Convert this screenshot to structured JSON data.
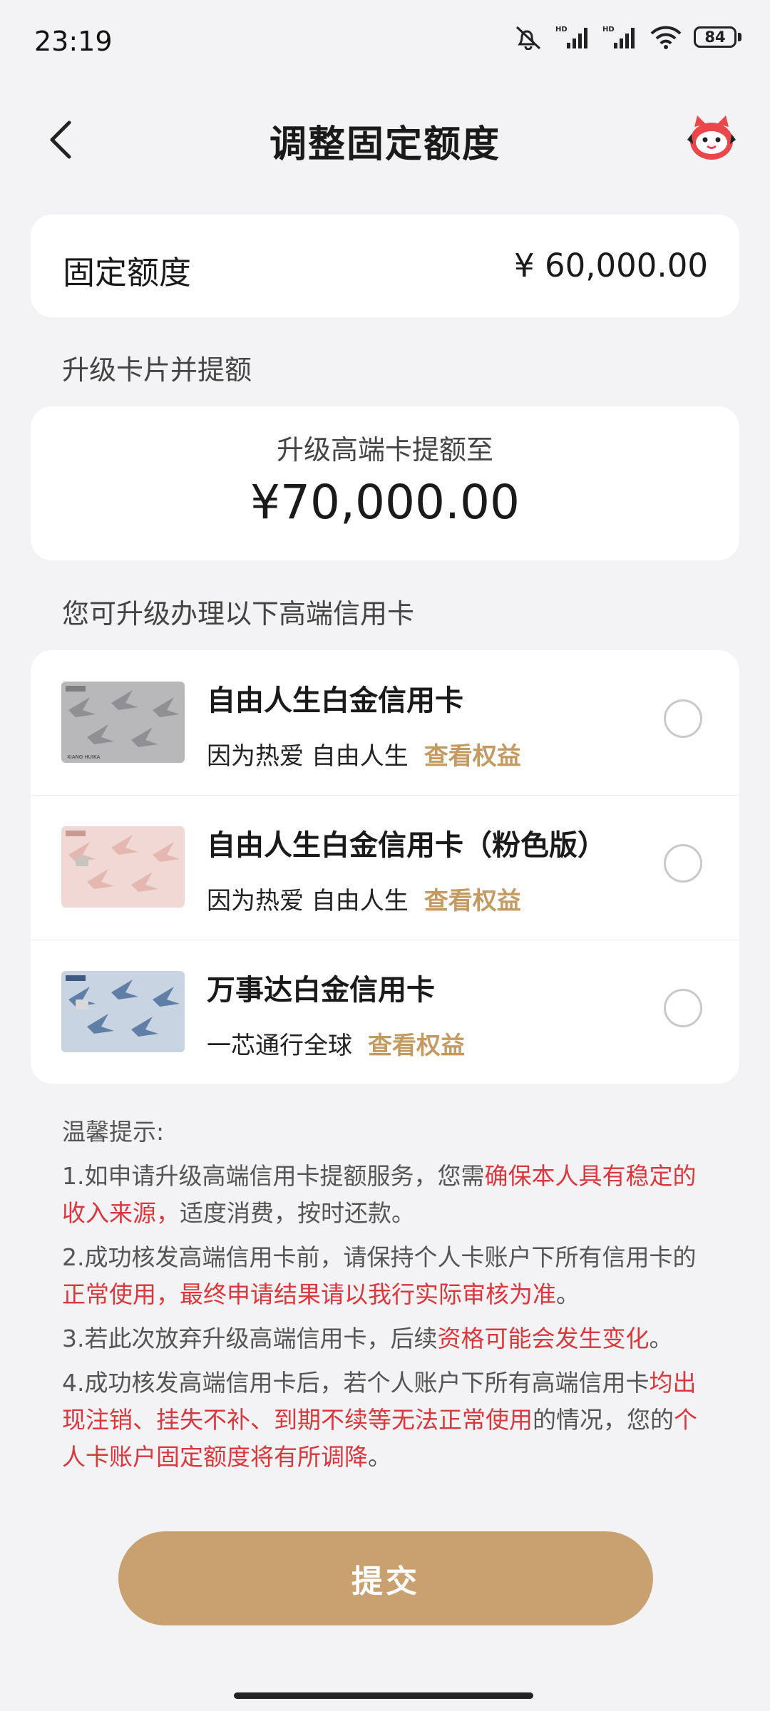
{
  "status_bar": {
    "time": "23:19",
    "battery": "84"
  },
  "nav": {
    "title": "调整固定额度"
  },
  "fixed_limit": {
    "label": "固定额度",
    "value": "¥ 60,000.00"
  },
  "upgrade_section_title": "升级卡片并提额",
  "upgrade": {
    "label": "升级高端卡提额至",
    "value": "¥70,000.00"
  },
  "cards_section_title": "您可升级办理以下高端信用卡",
  "cards": [
    {
      "name": "自由人生白金信用卡",
      "desc": "因为热爱 自由人生",
      "link": "查看权益"
    },
    {
      "name": "自由人生白金信用卡（粉色版）",
      "desc": "因为热爱 自由人生",
      "link": "查看权益"
    },
    {
      "name": "万事达白金信用卡",
      "desc": "一芯通行全球",
      "link": "查看权益"
    }
  ],
  "tips": {
    "title": "温馨提示:",
    "t1_a": "1.如申请升级高端信用卡提额服务，您需",
    "t1_b": "确保本人具有稳定的收入来源，",
    "t1_c": "适度消费，按时还款。",
    "t2_a": "2.成功核发高端信用卡前，请保持个人卡账户下所有信用卡的",
    "t2_b": "正常使用，最终申请结果请以我行实际审核为准",
    "t2_c": "。",
    "t3_a": "3.若此次放弃升级高端信用卡，后续",
    "t3_b": "资格可能会发生变化",
    "t3_c": "。",
    "t4_a": "4.成功核发高端信用卡后，若个人账户下所有高端信用卡",
    "t4_b": "均出现注销、挂失不补、到期不续等无法正常使用",
    "t4_c": "的情况，您的",
    "t4_d": "个人卡账户固定额度将有所调降",
    "t4_e": "。"
  },
  "submit_label": "提交",
  "colors": {
    "accent": "#c9a170",
    "link": "#c49a63",
    "warning": "#d9383d"
  }
}
